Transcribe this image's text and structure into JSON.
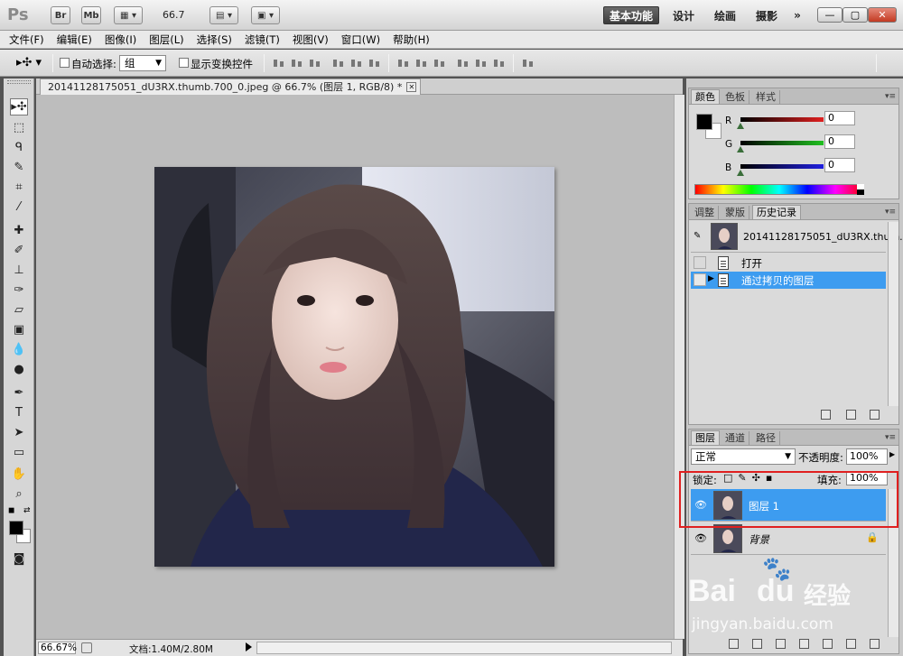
{
  "appbar": {
    "logo": "Ps",
    "bridge_label": "Br",
    "minibridge_label": "Mb",
    "zoom_value": "66.7",
    "workspace_active": "基本功能",
    "workspace_design": "设计",
    "workspace_paint": "绘画",
    "workspace_photo": "摄影",
    "workspace_more": "»"
  },
  "menubar": {
    "items": [
      "文件(F)",
      "编辑(E)",
      "图像(I)",
      "图层(L)",
      "选择(S)",
      "滤镜(T)",
      "视图(V)",
      "窗口(W)",
      "帮助(H)"
    ]
  },
  "options": {
    "auto_select_label": "自动选择:",
    "auto_select_value": "组",
    "show_transform_label": "显示变换控件"
  },
  "document": {
    "tab_title": "20141128175051_dU3RX.thumb.700_0.jpeg @ 66.7% (图层 1, RGB/8) *",
    "close_glyph": "✕"
  },
  "status": {
    "zoom": "66.67%",
    "doc_info": "文档:1.40M/2.80M"
  },
  "color_panel": {
    "tabs": [
      "颜色",
      "色板",
      "样式"
    ],
    "channels": [
      {
        "label": "R",
        "value": "0",
        "color": "#e02020"
      },
      {
        "label": "G",
        "value": "0",
        "color": "#20c020"
      },
      {
        "label": "B",
        "value": "0",
        "color": "#2020e0"
      }
    ],
    "fg_color": "#000000",
    "bg_color": "#ffffff"
  },
  "history_panel": {
    "tabs": [
      "调整",
      "蒙版",
      "历史记录"
    ],
    "snapshot_name": "20141128175051_dU3RX.thum...",
    "items": [
      {
        "label": "打开",
        "selected": false
      },
      {
        "label": "通过拷贝的图层",
        "selected": true
      }
    ]
  },
  "layers_panel": {
    "tabs": [
      "图层",
      "通道",
      "路径"
    ],
    "blend_mode": "正常",
    "opacity_label": "不透明度:",
    "opacity_value": "100%",
    "lock_label": "锁定:",
    "fill_label": "填充:",
    "fill_value": "100%",
    "layers": [
      {
        "name": "图层 1",
        "selected": true
      },
      {
        "name": "背景",
        "selected": false
      }
    ]
  },
  "watermark": {
    "brand": "Bai",
    "brand_suffix": "du",
    "cn": "经验",
    "url": "jingyan.baidu.com"
  },
  "colors": {
    "selection_blue": "#3d9cf0",
    "highlight_red": "#e02020"
  }
}
